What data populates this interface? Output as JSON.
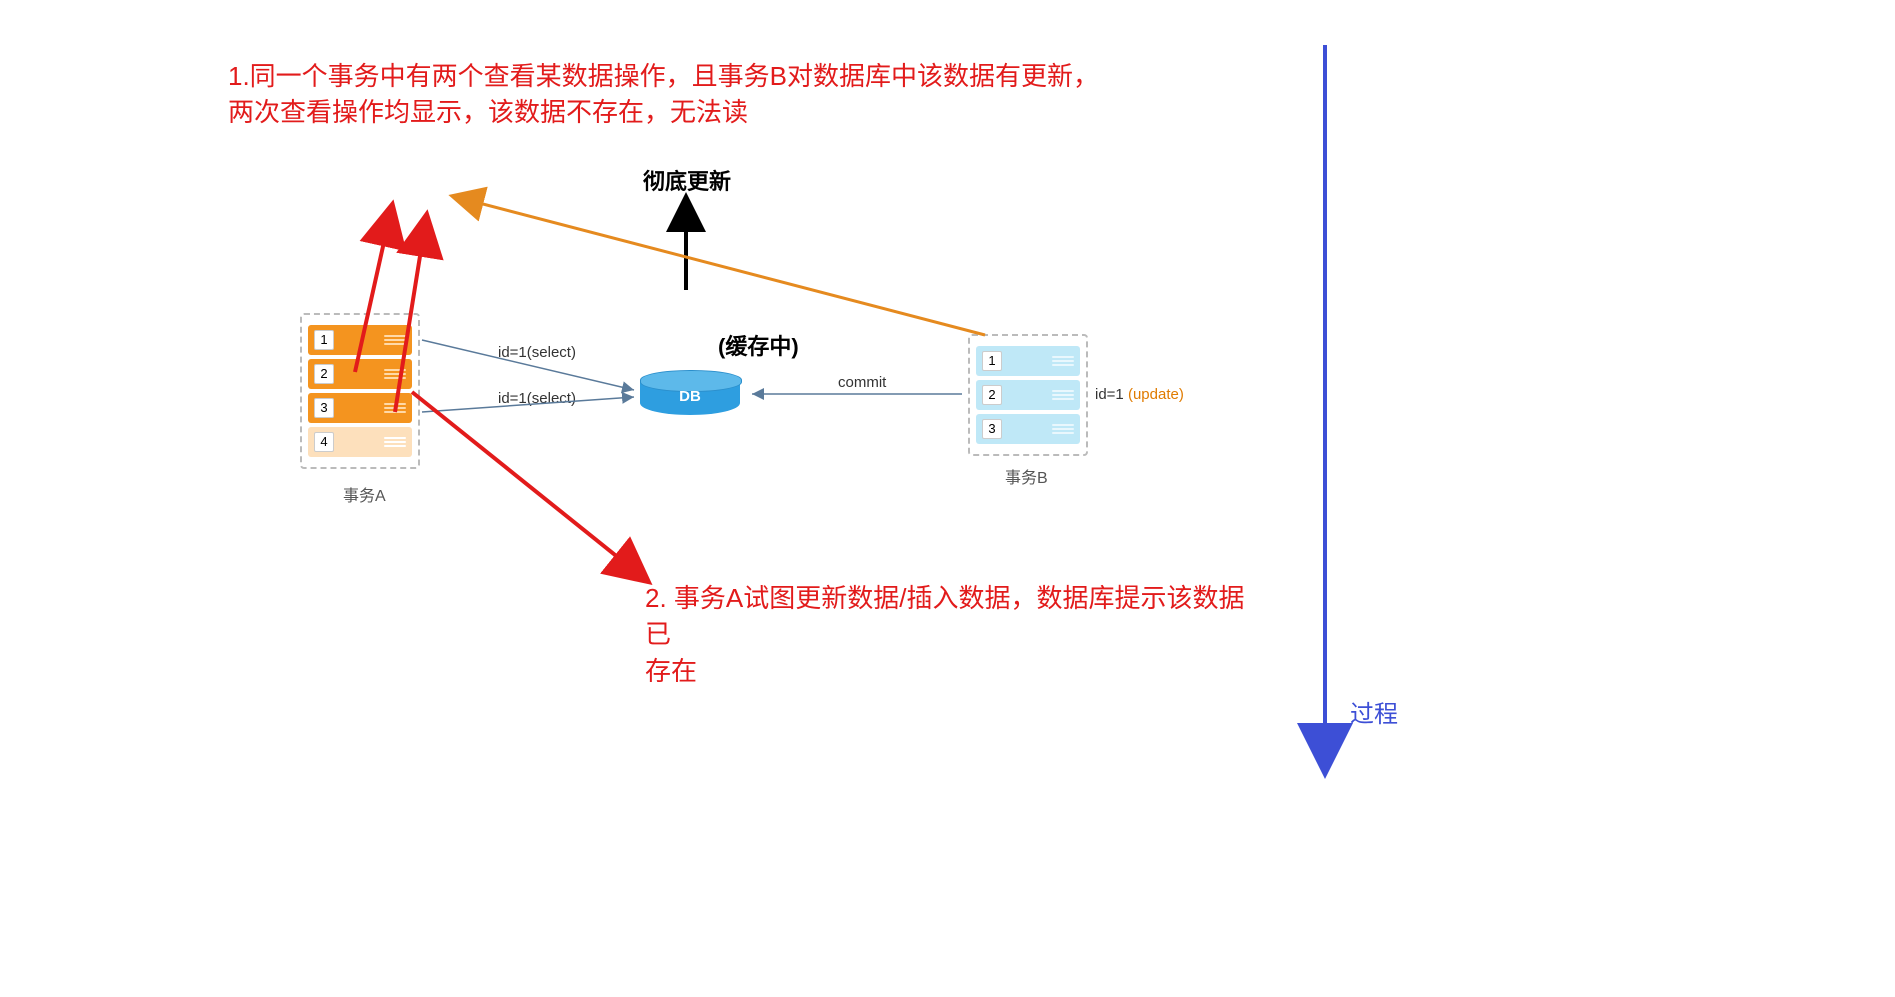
{
  "annotations": {
    "note1_line1": "1.同一个事务中有两个查看某数据操作，且事务B对数据库中该数据有更新，",
    "note1_line2": "两次查看操作均显示，该数据不存在，无法读",
    "note2_line1": "2. 事务A试图更新数据/插入数据，数据库提示该数据已",
    "note2_line2": "存在"
  },
  "labels": {
    "refresh": "彻底更新",
    "cache": "(缓存中)",
    "db": "DB",
    "txA": "事务A",
    "txB": "事务B",
    "select1": "id=1(select)",
    "select2": "id=1(select)",
    "commit": "commit",
    "update_pre": "id=1 ",
    "update_op": "(update)",
    "process": "过程"
  },
  "txA_rows": [
    "1",
    "2",
    "3",
    "4"
  ],
  "txB_rows": [
    "1",
    "2",
    "3"
  ]
}
